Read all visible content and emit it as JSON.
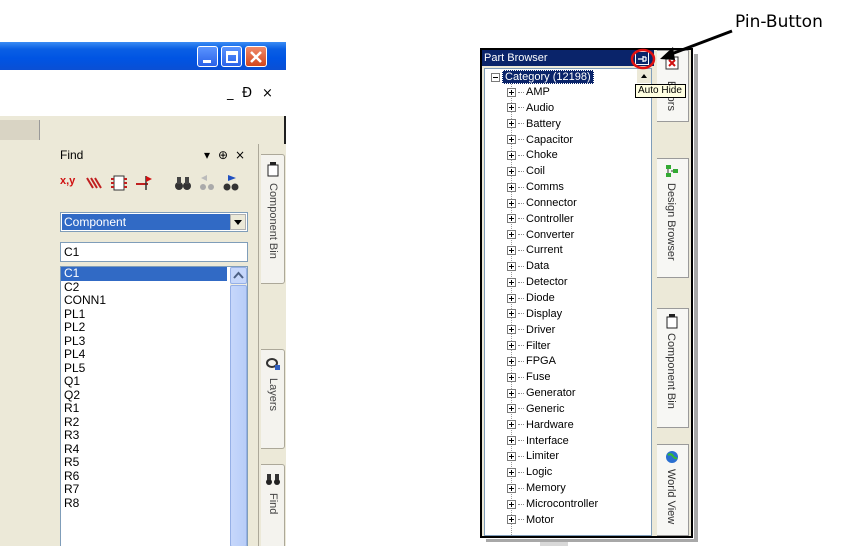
{
  "left_panel": {
    "mdi_buttons": [
      "_",
      "Ɖ",
      "×"
    ],
    "find_pane": {
      "title": "Find",
      "pane_buttons": [
        "▾",
        "⊕",
        "×"
      ],
      "toolbar_buttons": [
        "x,y"
      ],
      "combo_value": "Component",
      "search_value": "C1",
      "results": [
        "C1",
        "C2",
        "CONN1",
        "PL1",
        "PL2",
        "PL3",
        "PL4",
        "PL5",
        "Q1",
        "Q2",
        "R1",
        "R2",
        "R3",
        "R4",
        "R5",
        "R6",
        "R7",
        "R8"
      ],
      "selected_result": "C1"
    },
    "side_tabs": [
      "Component Bin",
      "Layers",
      "Find"
    ]
  },
  "part_browser": {
    "title": "Part Browser",
    "close_glyph": "×",
    "root": "Category (12198)",
    "categories": [
      "AMP",
      "Audio",
      "Battery",
      "Capacitor",
      "Choke",
      "Coil",
      "Comms",
      "Connector",
      "Controller",
      "Converter",
      "Current",
      "Data",
      "Detector",
      "Diode",
      "Display",
      "Driver",
      "Filter",
      "FPGA",
      "Fuse",
      "Generator",
      "Generic",
      "Hardware",
      "Interface",
      "Limiter",
      "Logic",
      "Memory",
      "Microcontroller",
      "Motor"
    ],
    "side_tabs": [
      "Errors",
      "Design Browser",
      "Component Bin",
      "World View"
    ],
    "tooltip": "Auto Hide"
  },
  "annotation": {
    "label": "Pin-Button"
  },
  "colors": {
    "xp_title_blue": "#0054e3",
    "selection_blue": "#316ac5",
    "part_browser_title": "#0a246a",
    "callout_red": "#e01010"
  },
  "icons": [
    "minimize-icon",
    "restore-icon",
    "close-icon",
    "pin-icon",
    "find-binoculars-icon",
    "layers-icon",
    "component-bin-icon",
    "world-view-icon",
    "design-browser-icon",
    "dropdown-arrow-icon"
  ]
}
